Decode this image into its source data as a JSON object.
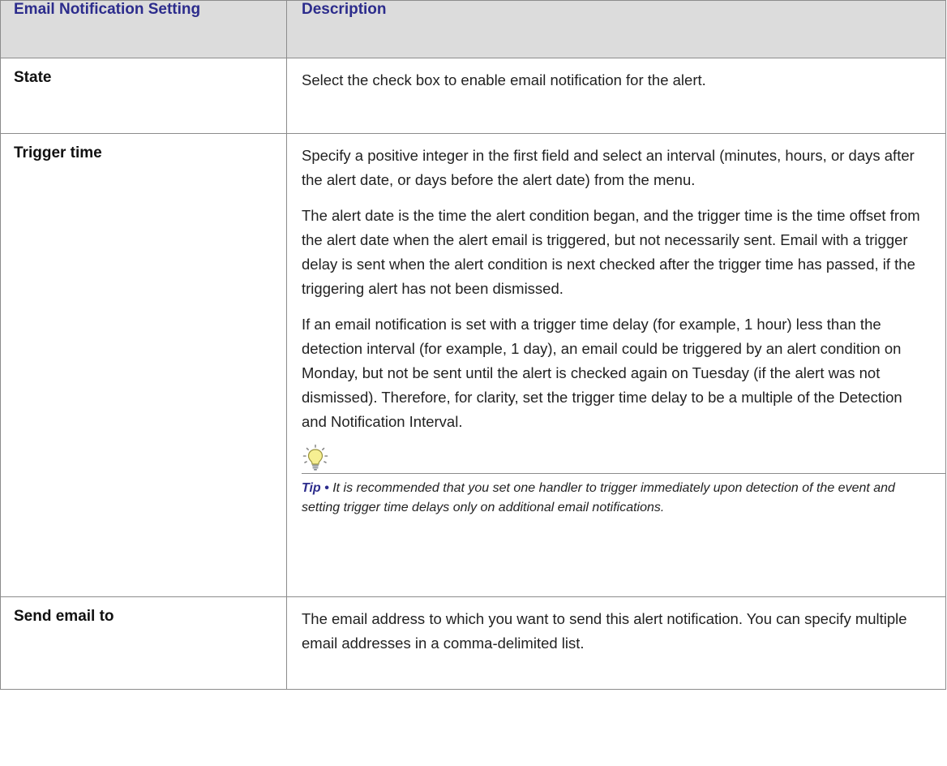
{
  "table": {
    "headers": [
      "Email Notification Setting",
      "Description"
    ],
    "rows": [
      {
        "setting": "State",
        "paragraphs": [
          "Select the check box to enable email notification for the alert."
        ]
      },
      {
        "setting": "Trigger time",
        "paragraphs": [
          "Specify a positive integer in the first field and select an interval (minutes, hours, or days after the alert date, or days before the alert date) from the menu.",
          "The alert date is the time the alert condition began, and the trigger time is the time offset from the alert date when the alert email is triggered, but not necessarily sent. Email with a trigger delay is sent when the alert condition is next checked after the trigger time has passed, if the triggering alert has not been dismissed.",
          "If an email notification is set with a trigger time delay (for example, 1 hour) less than the detection interval (for example, 1 day), an email could be triggered by an alert condition on Monday, but not be sent until the alert is checked again on Tuesday (if the alert was not dismissed). Therefore, for clarity, set the trigger time delay to be a multiple of the Detection and Notification Interval."
        ],
        "tip": {
          "icon": "lightbulb-icon",
          "label": "Tip •",
          "text": "It is recommended that you set one handler to trigger immediately upon detection of the event and setting trigger time delays only on additional email notifications."
        }
      },
      {
        "setting": "Send email to",
        "paragraphs": [
          "The email address to which you want to send this alert notification. You can specify multiple email addresses in a comma-delimited list."
        ]
      }
    ]
  },
  "colors": {
    "header_text": "#2c2c8c",
    "header_bg": "#dcdcdc",
    "border": "#8c8c8c"
  }
}
